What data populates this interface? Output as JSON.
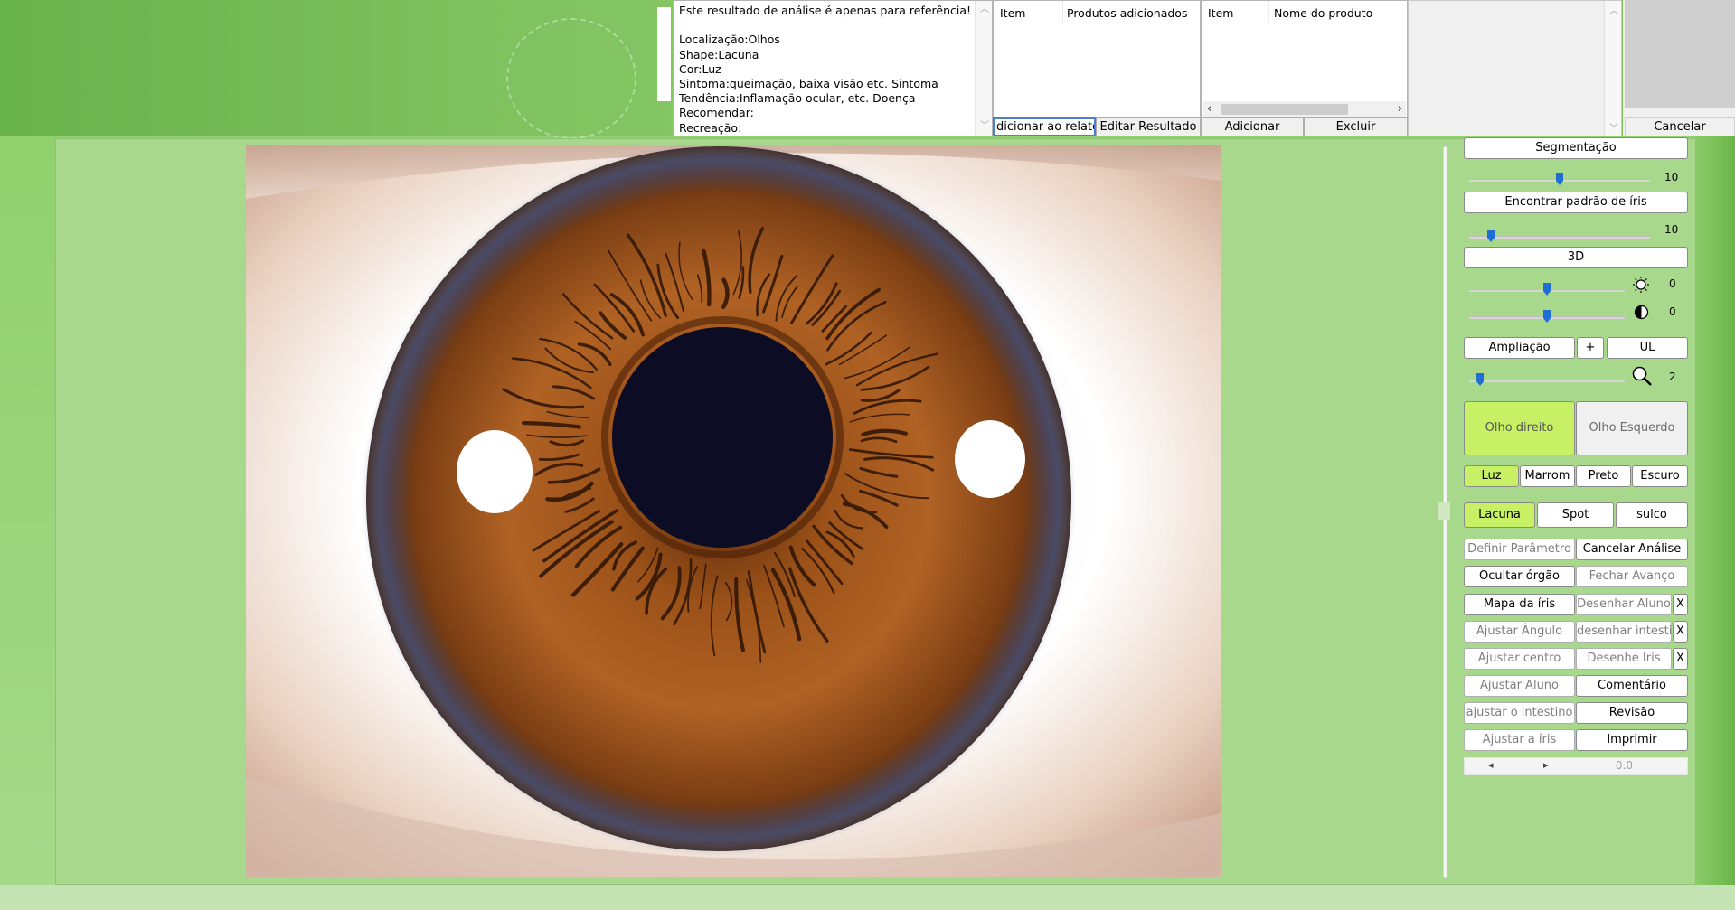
{
  "analysis": {
    "lines": [
      "Este resultado de análise é apenas para referência!",
      "",
      "Localização:Olhos",
      "Shape:Lacuna",
      "Cor:Luz",
      "Sintoma:queimação, baixa visão etc. Sintoma",
      "Tendência:Inflamação ocular, etc. Doença",
      "Recomendar:",
      "Recreação:"
    ]
  },
  "list_added": {
    "col1": "Item",
    "col2": "Produtos adicionados"
  },
  "list_products": {
    "col1": "Item",
    "col2": "Nome do produto"
  },
  "top_buttons": {
    "add_report": "dicionar ao relatóri",
    "edit_result": "Editar Resultado",
    "add": "Adicionar",
    "delete": "Excluir",
    "cancel": "Cancelar"
  },
  "controls": {
    "segmentation": "Segmentação",
    "segmentation_value": "10",
    "segmentation_level": 0.5,
    "find_iris_pattern": "Encontrar padrão de íris",
    "find_iris_value": "10",
    "find_iris_level": 0.12,
    "three_d": "3D",
    "brightness_value": "0",
    "brightness_level": 0.5,
    "contrast_value": "0",
    "contrast_level": 0.5,
    "magnification": "Ampliação",
    "plus": "+",
    "ul": "UL",
    "zoom_value": "2",
    "zoom_level": 0.07,
    "right_eye": "Olho direito",
    "left_eye": "Olho Esquerdo",
    "colors": [
      "Luz",
      "Marrom",
      "Preto",
      "Escuro"
    ],
    "shapes": [
      "Lacuna",
      "Spot",
      "sulco"
    ],
    "define_parameter": "Definir Parâmetro",
    "cancel_analysis": "Cancelar Análise",
    "hide_organ": "Ocultar órgão",
    "close_advance": "Fechar Avanço",
    "iris_map": "Mapa da íris",
    "draw_pupil": "Desenhar Aluno",
    "adjust_angle": "Ajustar Ângulo",
    "draw_intestine": "desenhar intestino",
    "adjust_center": "Ajustar centro",
    "draw_iris": "Desenhe Iris",
    "adjust_pupil": "Ajustar Aluno",
    "comment": "Comentário",
    "adjust_intestine": "ajustar o intestino",
    "review": "Revisão",
    "adjust_iris": "Ajustar a íris",
    "print": "Imprimir",
    "x": "X",
    "nav_value": "0.0"
  }
}
